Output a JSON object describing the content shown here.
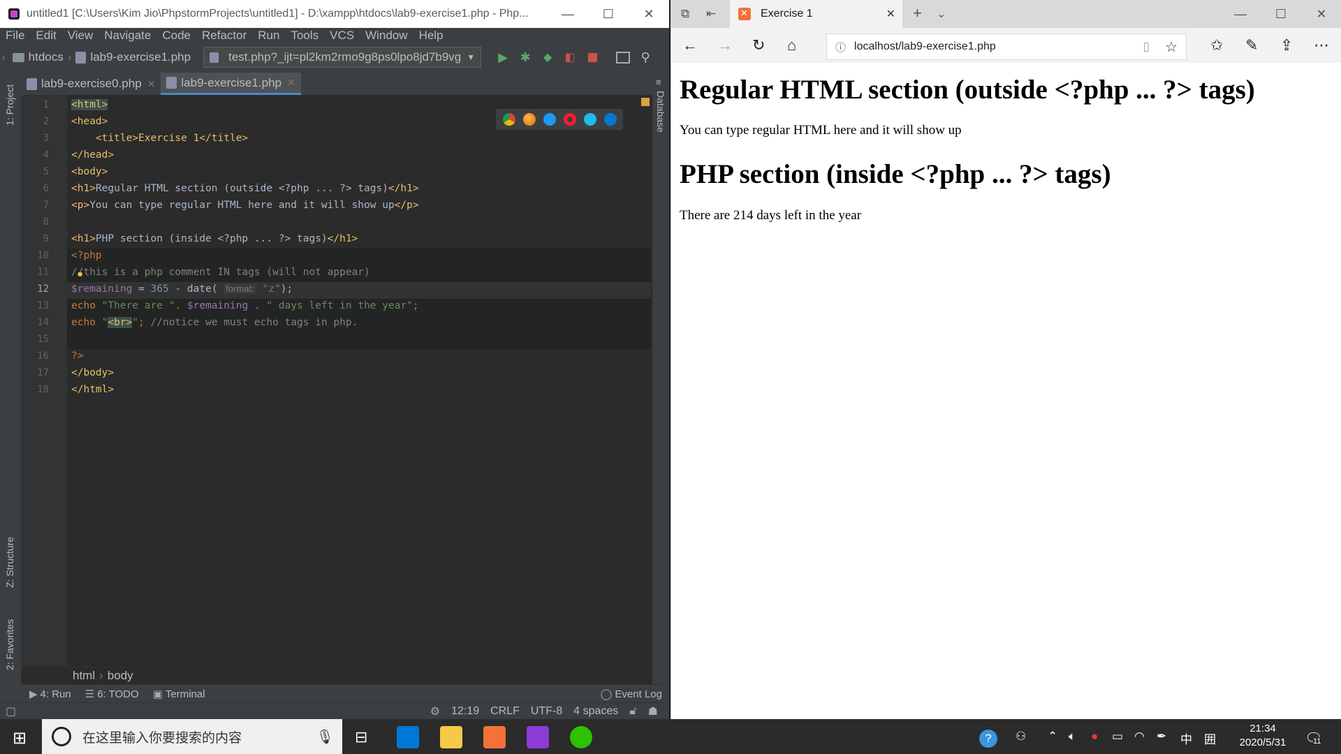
{
  "ide": {
    "title": "untitled1 [C:\\Users\\Kim Jio\\PhpstormProjects\\untitled1] - D:\\xampp\\htdocs\\lab9-exercise1.php - Php...",
    "menu": [
      "File",
      "Edit",
      "View",
      "Navigate",
      "Code",
      "Refactor",
      "Run",
      "Tools",
      "VCS",
      "Window",
      "Help"
    ],
    "breadcrumb_folder": "htdocs",
    "breadcrumb_file": "lab9-exercise1.php",
    "run_config": "test.php?_ijt=pl2km2rmo9g8ps0lpo8jd7b9vg",
    "tabs": [
      {
        "label": "lab9-exercise0.php"
      },
      {
        "label": "lab9-exercise1.php"
      }
    ],
    "left_tools": [
      "1: Project",
      "Z: Structure",
      "2: Favorites"
    ],
    "right_tools": [
      "Database"
    ],
    "line_numbers": [
      "1",
      "2",
      "3",
      "4",
      "5",
      "6",
      "7",
      "8",
      "9",
      "10",
      "11",
      "12",
      "13",
      "14",
      "15",
      "16",
      "17",
      "18"
    ],
    "code": {
      "l1": "<html>",
      "l2": "<head>",
      "l3": "    <title>Exercise 1</title>",
      "l4": "</head>",
      "l5": "<body>",
      "l6a": "<h1>",
      "l6b": "Regular HTML section (outside <?php ... ?> tags)",
      "l6c": "</h1>",
      "l7a": "<p>",
      "l7b": "You can type regular HTML here and it will show up",
      "l7c": "</p>",
      "l9a": "<h1>",
      "l9b": "PHP section (inside <?php ... ?> tags)",
      "l9c": "</h1>",
      "l10": "<?php",
      "l11": "//this is a php comment IN tags (will not appear)",
      "l12_var": "$remaining",
      "l12_eq": " = ",
      "l12_num": "365",
      "l12_mid": " - date( ",
      "l12_hint": "format:",
      "l12_str": " \"z\"",
      "l12_end": ");",
      "l13_kw": "echo ",
      "l13_s1": "\"There are \"",
      "l13_dot1": ". ",
      "l13_var": "$remaining",
      "l13_dot2": " . ",
      "l13_s2": "\" days left in the year\"",
      "l13_end": ";",
      "l14_kw": "echo ",
      "l14_q1": "\"",
      "l14_br": "<br>",
      "l14_q2": "\"",
      "l14_semi": "; ",
      "l14_cmt": "//notice we must echo tags in php.",
      "l16": "?>",
      "l17": "</body>",
      "l18": "</html>"
    },
    "path": [
      "html",
      "body"
    ],
    "toolwindows": {
      "run": "4: Run",
      "todo": "6: TODO",
      "terminal": "Terminal",
      "event_log": "Event Log"
    },
    "status": {
      "position": "12:19",
      "line_sep": "CRLF",
      "encoding": "UTF-8",
      "indent": "4 spaces"
    }
  },
  "browser": {
    "tab_title": "Exercise 1",
    "url": "localhost/lab9-exercise1.php",
    "page": {
      "h1_a": "Regular HTML section (outside <?php ... ?> tags)",
      "p_a": "You can type regular HTML here and it will show up",
      "h1_b": "PHP section (inside <?php ... ?> tags)",
      "p_b": "There are 214 days left in the year"
    }
  },
  "taskbar": {
    "search_placeholder": "在这里输入你要搜索的内容",
    "ime": "中",
    "ime2": "囲",
    "time": "21:34",
    "date": "2020/5/31",
    "notif_count": "11"
  },
  "colors": {
    "accent": "#4a88c7",
    "tag": "#e8bf6a",
    "keyword": "#cc7832",
    "string": "#6a8759",
    "variable": "#9876aa",
    "number": "#6897bb"
  }
}
